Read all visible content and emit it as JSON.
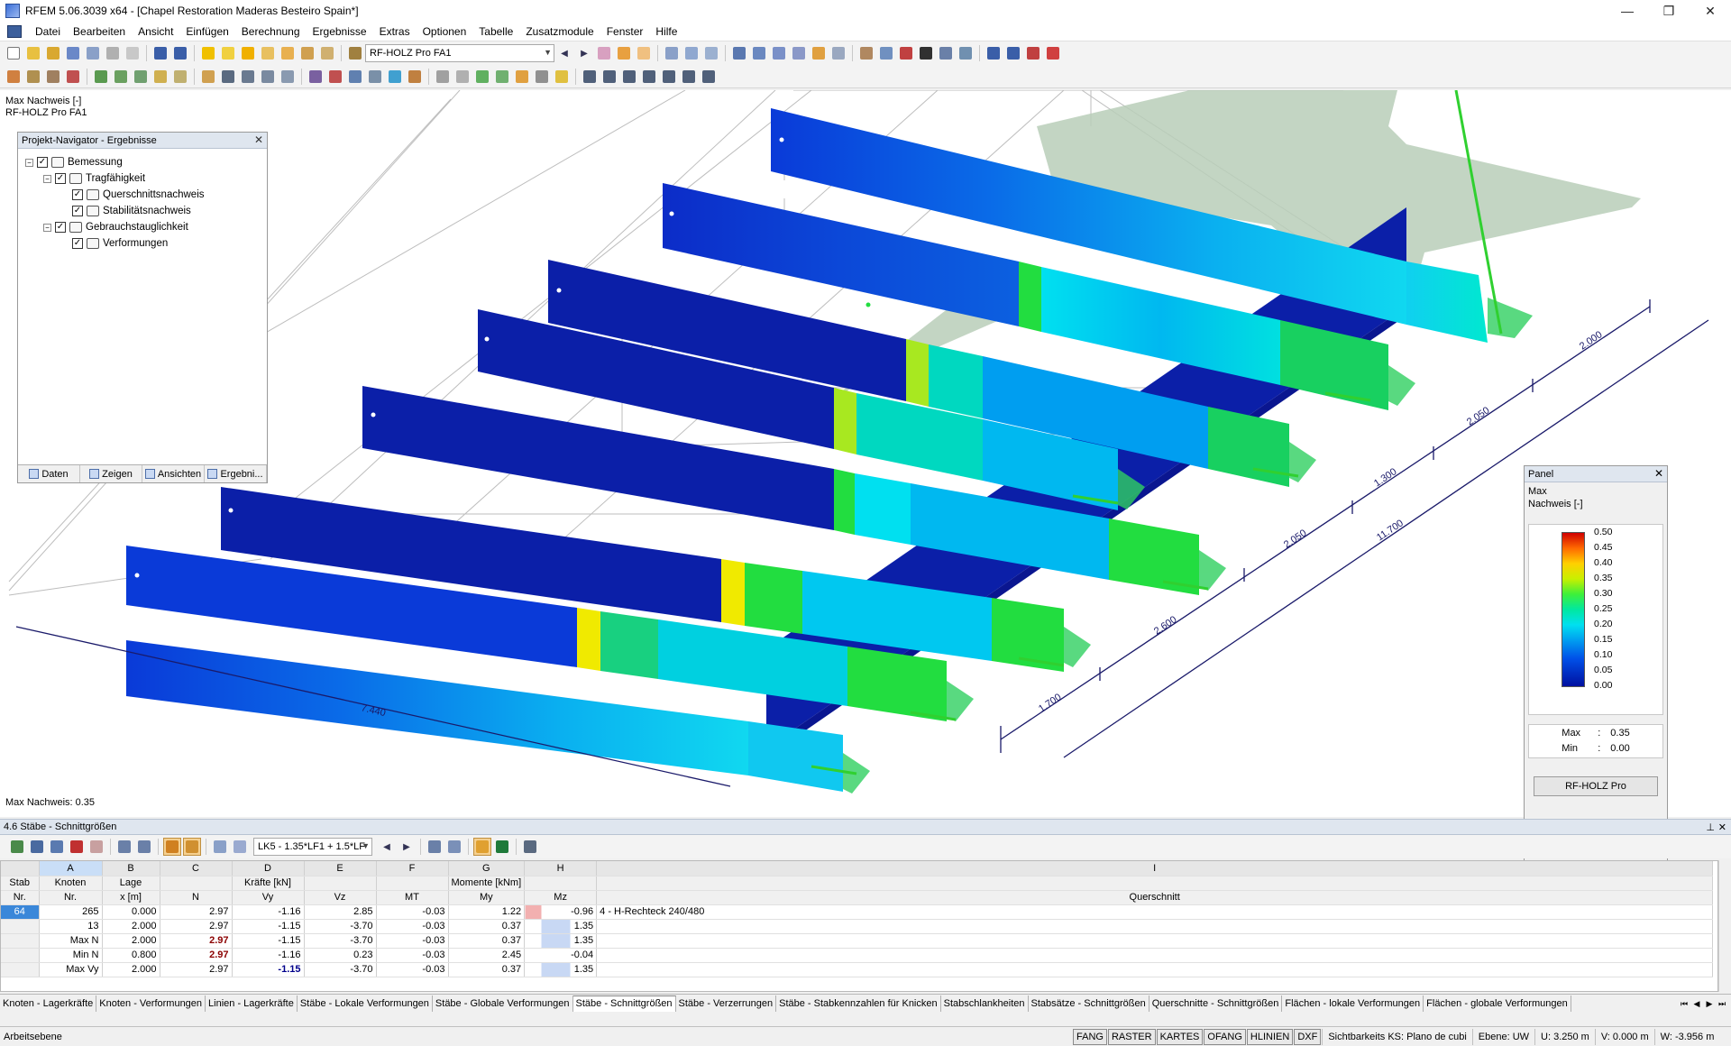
{
  "window": {
    "title": "RFEM 5.06.3039 x64 - [Chapel Restoration Maderas Besteiro Spain*]",
    "buttons": [
      "—",
      "❐",
      "✕"
    ]
  },
  "menu": [
    "Datei",
    "Bearbeiten",
    "Ansicht",
    "Einfügen",
    "Berechnung",
    "Ergebnisse",
    "Extras",
    "Optionen",
    "Tabelle",
    "Zusatzmodule",
    "Fenster",
    "Hilfe"
  ],
  "toolbar": {
    "module_combo": "RF-HOLZ Pro FA1"
  },
  "viewport": {
    "info_line1": "Max Nachweis [-]",
    "info_line2": "RF-HOLZ Pro FA1",
    "bottom_label": "Max Nachweis: 0.35",
    "dimensions": [
      "7.440",
      "1.700",
      "2.600",
      "2.050",
      "1.300",
      "2.050",
      "2.000",
      "11.700"
    ]
  },
  "navigator": {
    "title": "Projekt-Navigator - Ergebnisse",
    "tree": [
      {
        "label": "Bemessung",
        "level": 0
      },
      {
        "label": "Tragfähigkeit",
        "level": 1
      },
      {
        "label": "Querschnittsnachweis",
        "level": 2
      },
      {
        "label": "Stabilitätsnachweis",
        "level": 2
      },
      {
        "label": "Gebrauchstauglichkeit",
        "level": 1
      },
      {
        "label": "Verformungen",
        "level": 2
      }
    ],
    "tabs": [
      "Daten",
      "Zeigen",
      "Ansichten",
      "Ergebni..."
    ]
  },
  "panel": {
    "title": "Panel",
    "line1": "Max",
    "line2": "Nachweis [-]",
    "scale": [
      "0.50",
      "0.45",
      "0.40",
      "0.35",
      "0.30",
      "0.25",
      "0.20",
      "0.15",
      "0.10",
      "0.05",
      "0.00"
    ],
    "max_label": "Max",
    "max_value": "0.35",
    "min_label": "Min",
    "min_value": "0.00",
    "sep": ":",
    "button": "RF-HOLZ Pro",
    "colors": [
      "#d00000",
      "#ff6a00",
      "#ffd000",
      "#c8f000",
      "#3ef03a",
      "#00e8a0",
      "#00e0f0",
      "#009ef0",
      "#0050e8",
      "#0010a0"
    ]
  },
  "table": {
    "title": "4.6 Stäbe - Schnittgrößen",
    "load_combo": "LK5 - 1.35*LF1 + 1.5*LF",
    "col_letters": [
      "A",
      "B",
      "C",
      "D",
      "E",
      "F",
      "G",
      "H",
      "I"
    ],
    "group_headers": {
      "kraefte": "Kräfte [kN]",
      "momente": "Momente [kNm]"
    },
    "headers": {
      "stab": "Stab",
      "nr": "Nr.",
      "knoten": "Knoten",
      "knoten_nr": "Nr.",
      "lage": "Lage",
      "lage_x": "x [m]",
      "n": "N",
      "vy": "Vy",
      "vz": "Vz",
      "mt": "MT",
      "my": "My",
      "mz": "Mz",
      "querschnitt": "Querschnitt"
    },
    "rows": [
      {
        "stab": "64",
        "knoten": "265",
        "x": "0.000",
        "n": "2.97",
        "vy": "-1.16",
        "vz": "2.85",
        "mt": "-0.03",
        "my": "1.22",
        "mz": "-0.96",
        "qs": "4 - H-Rechteck 240/480"
      },
      {
        "stab": "",
        "knoten": "13",
        "x": "2.000",
        "n": "2.97",
        "vy": "-1.15",
        "vz": "-3.70",
        "mt": "-0.03",
        "my": "0.37",
        "mz": "1.35",
        "qs": ""
      },
      {
        "stab": "",
        "knoten": "Max N",
        "x": "2.000",
        "n": "2.97",
        "vy": "-1.15",
        "vz": "-3.70",
        "mt": "-0.03",
        "my": "0.37",
        "mz": "1.35",
        "qs": ""
      },
      {
        "stab": "",
        "knoten": "Min N",
        "x": "0.800",
        "n": "2.97",
        "vy": "-1.16",
        "vz": "0.23",
        "mt": "-0.03",
        "my": "2.45",
        "mz": "-0.04",
        "qs": ""
      },
      {
        "stab": "",
        "knoten": "Max Vy",
        "x": "2.000",
        "n": "2.97",
        "vy": "-1.15",
        "vz": "-3.70",
        "mt": "-0.03",
        "my": "0.37",
        "mz": "1.35",
        "qs": ""
      }
    ]
  },
  "sheet_tabs": [
    "Knoten - Lagerkräfte",
    "Knoten - Verformungen",
    "Linien - Lagerkräfte",
    "Stäbe - Lokale Verformungen",
    "Stäbe - Globale Verformungen",
    "Stäbe - Schnittgrößen",
    "Stäbe - Verzerrungen",
    "Stäbe - Stabkennzahlen für Knicken",
    "Stabschlankheiten",
    "Stabsätze - Schnittgrößen",
    "Querschnitte - Schnittgrößen",
    "Flächen - lokale Verformungen",
    "Flächen - globale Verformungen"
  ],
  "active_sheet": "Stäbe - Schnittgrößen",
  "status": {
    "left": "Arbeitsebene",
    "toggles": [
      "FANG",
      "RASTER",
      "KARTES",
      "OFANG",
      "HLINIEN",
      "DXF"
    ],
    "ks": "Sichtbarkeits KS: Plano de cubi",
    "ebene": "Ebene: UW",
    "u": "U: 3.250 m",
    "v": "V: 0.000 m",
    "w": "W: -3.956 m"
  }
}
